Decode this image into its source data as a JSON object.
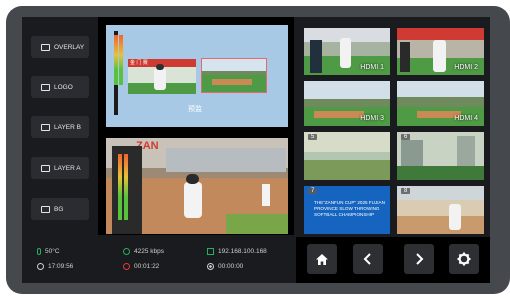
{
  "sidebar": {
    "items": [
      {
        "label": "OVERLAY",
        "icon": "monitor-icon"
      },
      {
        "label": "LOGO",
        "icon": "logo-icon"
      },
      {
        "label": "LAYER B",
        "icon": "layer-icon"
      },
      {
        "label": "LAYER A",
        "icon": "layer-icon"
      },
      {
        "label": "BG",
        "icon": "image-icon"
      }
    ]
  },
  "preview": {
    "label": "预监",
    "banner_text": "金 门 赛"
  },
  "program": {
    "banner_text": "ZAN"
  },
  "sources": [
    {
      "label": "HDMI 1",
      "number": ""
    },
    {
      "label": "HDMI 2",
      "number": ""
    },
    {
      "label": "HDMI 3",
      "number": ""
    },
    {
      "label": "HDMI 4",
      "number": ""
    },
    {
      "label": "",
      "number": "5"
    },
    {
      "label": "",
      "number": "6"
    },
    {
      "label": "",
      "number": "7",
      "caption": "THE\"ZANFUN CUP\" 2025 FUJIAN PROVINCE SLOW THROWING SOFTBALL CHAMPIONSHIP"
    },
    {
      "label": "",
      "number": "8"
    }
  ],
  "status": {
    "temperature": "50°C",
    "bitrate": "4225 kbps",
    "ip": "192.168.100.168",
    "clock": "17:09:56",
    "record_time": "00:01:22",
    "stream_time": "00:00:00"
  },
  "colors": {
    "accent_green": "#27ae60",
    "record_red": "#e53935",
    "blue_card": "#1565c0"
  }
}
